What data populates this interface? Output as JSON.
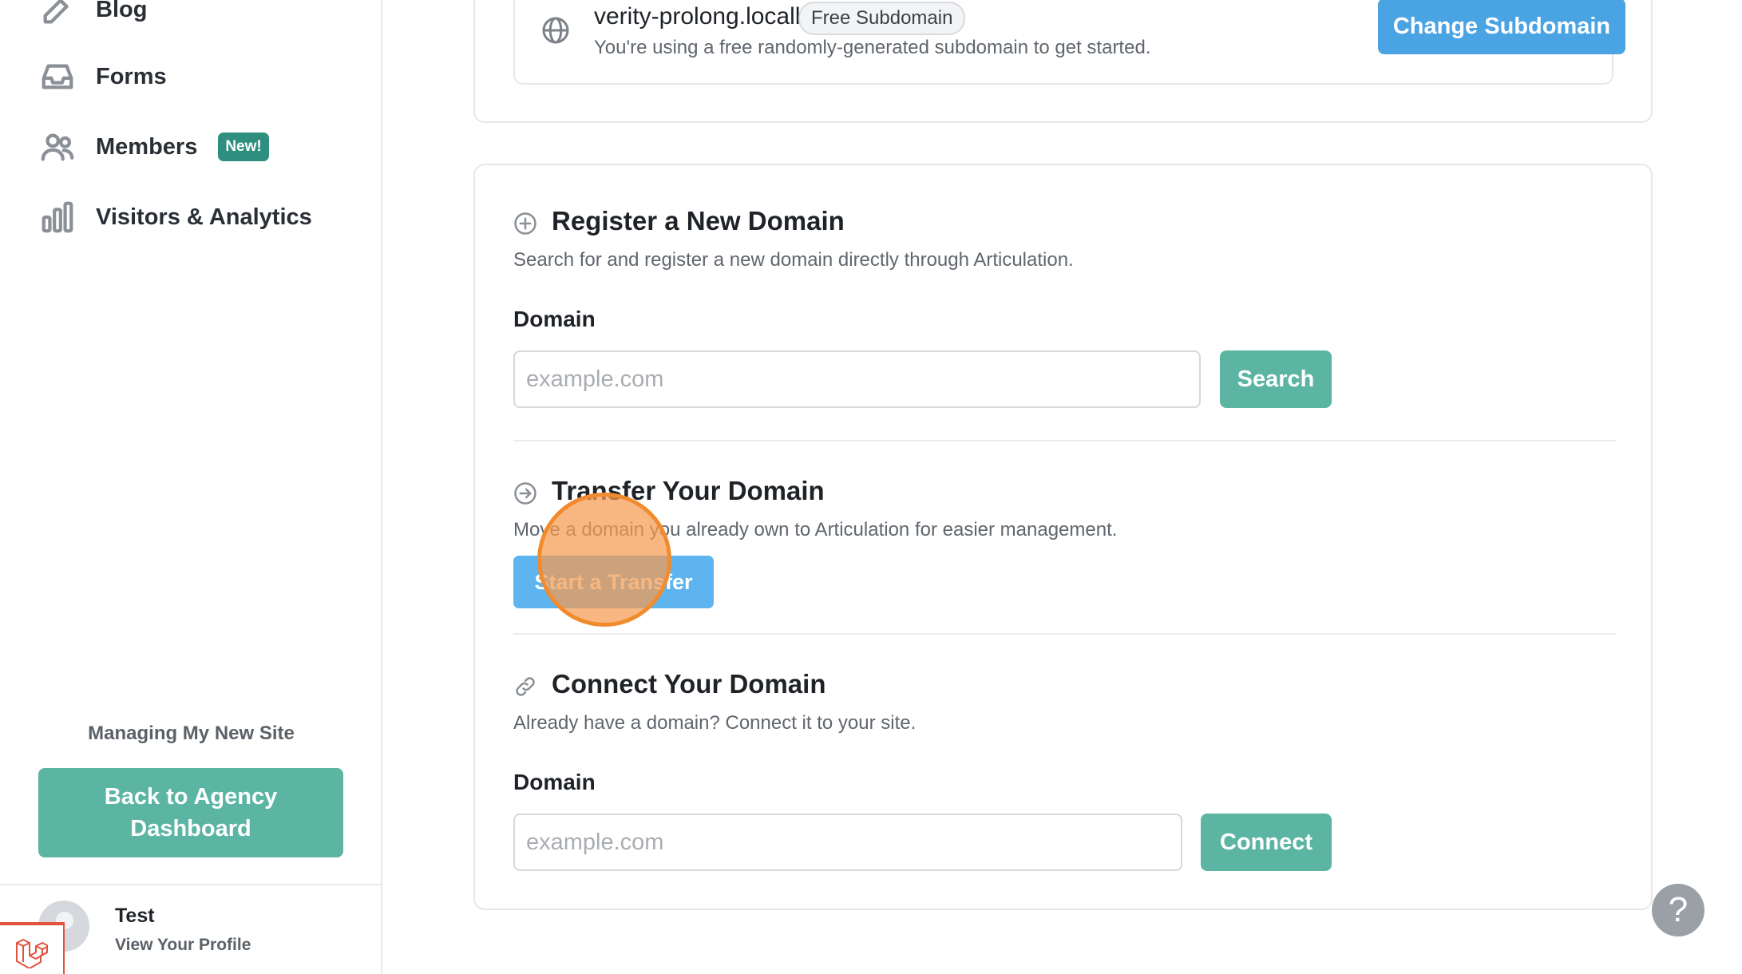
{
  "sidebar": {
    "items": [
      {
        "label": "Blog",
        "icon": "pencil-square-icon"
      },
      {
        "label": "Forms",
        "icon": "inbox-icon"
      },
      {
        "label": "Members",
        "icon": "users-icon",
        "badge": "New!"
      },
      {
        "label": "Visitors & Analytics",
        "icon": "bar-chart-icon"
      }
    ],
    "managing_text": "Managing My New Site",
    "back_button": "Back to Agency Dashboard",
    "profile": {
      "name": "Test",
      "link": "View Your Profile"
    }
  },
  "subdomain": {
    "domain": "verity-prolong.localhost",
    "pill": "Free Subdomain",
    "description": "You're using a free randomly-generated subdomain to get started.",
    "change_button": "Change Subdomain"
  },
  "register": {
    "title": "Register a New Domain",
    "description": "Search for and register a new domain directly through Articulation.",
    "field_label": "Domain",
    "placeholder": "example.com",
    "button": "Search"
  },
  "transfer": {
    "title": "Transfer Your Domain",
    "description": "Move a domain you already own to Articulation for easier management.",
    "button": "Start a Transfer"
  },
  "connect": {
    "title": "Connect Your Domain",
    "description": "Already have a domain? Connect it to your site.",
    "field_label": "Domain",
    "placeholder": "example.com",
    "button": "Connect"
  },
  "help": {
    "label": "?"
  },
  "colors": {
    "teal": "#5bb5a2",
    "blue": "#4aa3e3",
    "click_marker": "#f28b2e",
    "laravel": "#e0533f"
  }
}
